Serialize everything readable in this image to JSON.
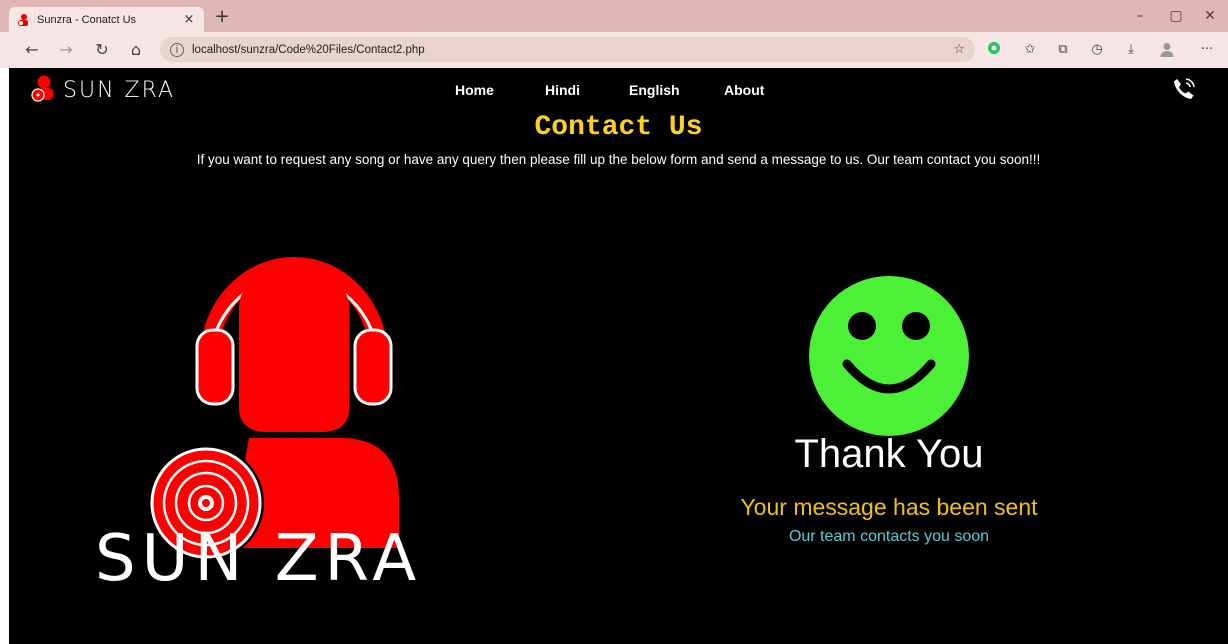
{
  "browser": {
    "tab_title": "Sunzra - Conatct Us",
    "tab_close": "×",
    "new_tab": "+",
    "url": "localhost/sunzra/Code%20Files/Contact2.php",
    "window_controls": {
      "minimize": "–",
      "restore": "▢",
      "close": "✕"
    },
    "icons": [
      "back-icon",
      "forward-icon",
      "refresh-icon",
      "home-icon",
      "info-icon",
      "favorites-star-icon",
      "extension-icon",
      "favorites-icon",
      "collections-icon",
      "history-icon",
      "downloads-icon",
      "profile-icon",
      "more-icon"
    ]
  },
  "site": {
    "brand": "SUN ZRA",
    "nav": [
      "Home",
      "Hindi",
      "English",
      "About"
    ],
    "heading": "Contact Us",
    "subtext": "If you want to request any song or have any query then please fill up the below form and send a message to us. Our team contact you soon!!!",
    "logo_text": "SUN ZRA",
    "thank_you": "Thank You",
    "message_sent": "Your message has been sent",
    "contact_soon": "Our team contacts you soon"
  },
  "colors": {
    "accent_yellow": "#ffd21a",
    "brand_red": "#ff0000",
    "smiley_green": "#4cf037",
    "cyan_text": "#4fd0d6",
    "tabbar": "#dfb7b4"
  }
}
